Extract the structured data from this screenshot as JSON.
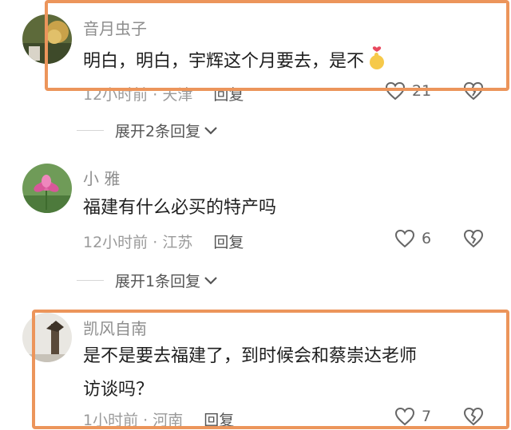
{
  "comments": [
    {
      "username": "音月虫子",
      "text": "明白，明白，宇辉这个月要去，是不",
      "meta_time": "12小时前",
      "meta_sep": "·",
      "meta_location": "天津",
      "reply_label": "回复",
      "likes": "21",
      "expand_label": "展开2条回复"
    },
    {
      "username": "小 雅",
      "text": "福建有什么必买的特产吗",
      "meta_time": "12小时前",
      "meta_sep": "·",
      "meta_location": "江苏",
      "reply_label": "回复",
      "likes": "6",
      "expand_label": "展开1条回复"
    },
    {
      "username": "凯风自南",
      "text_line1": "是不是要去福建了，到时候会和蔡崇达老师",
      "text_line2": "访谈吗？",
      "meta_time": "1小时前",
      "meta_sep": "·",
      "meta_location": "河南",
      "reply_label": "回复",
      "likes": "7"
    }
  ],
  "icons": {
    "like": "heart-outline-icon",
    "dislike": "broken-heart-icon",
    "expand": "chevron-down-icon",
    "emoji": "finger-heart-emoji-icon"
  },
  "colors": {
    "highlight_border": "#ec955b",
    "username": "#8e8e8e",
    "meta": "#9a9a9a"
  }
}
